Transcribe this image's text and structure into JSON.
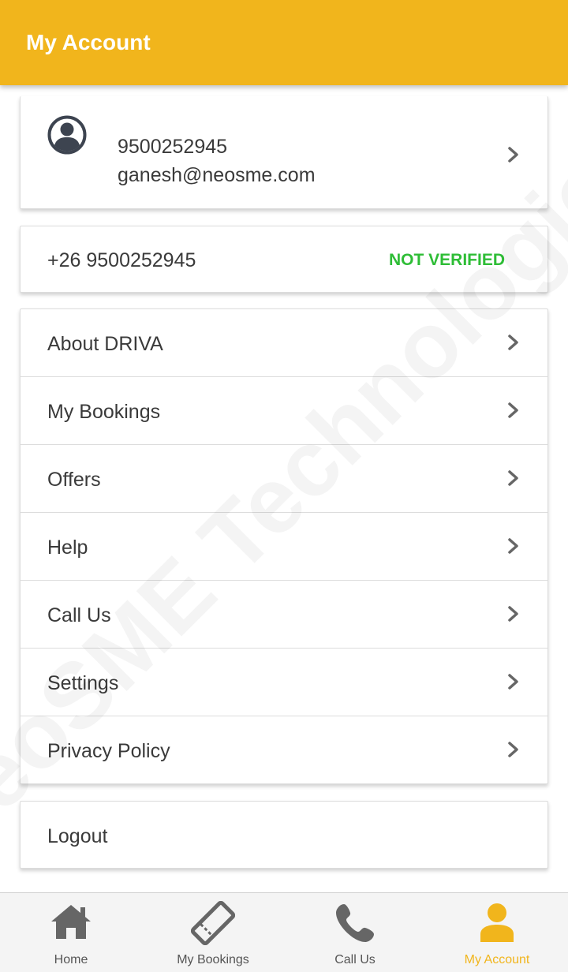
{
  "app_bar": {
    "title": "My Account"
  },
  "profile": {
    "phone": "9500252945",
    "email": "ganesh@neosme.com"
  },
  "phone_verification": {
    "number": "+26 9500252945",
    "status": "NOT VERIFIED"
  },
  "menu": {
    "items": [
      {
        "label": "About DRIVA"
      },
      {
        "label": "My Bookings"
      },
      {
        "label": "Offers"
      },
      {
        "label": "Help"
      },
      {
        "label": "Call Us"
      },
      {
        "label": "Settings"
      },
      {
        "label": "Privacy Policy"
      }
    ]
  },
  "logout": {
    "label": "Logout"
  },
  "watermark": "NeoSME Technologies",
  "bottom_nav": {
    "items": [
      {
        "label": "Home",
        "icon": "home-icon"
      },
      {
        "label": "My Bookings",
        "icon": "ticket-icon"
      },
      {
        "label": "Call Us",
        "icon": "phone-icon"
      },
      {
        "label": "My Account",
        "icon": "user-icon",
        "active": true
      }
    ]
  },
  "colors": {
    "primary": "#f1b51c",
    "verify_status": "#2ebd36",
    "text": "#3a3a3a",
    "icon_gray": "#666666"
  }
}
